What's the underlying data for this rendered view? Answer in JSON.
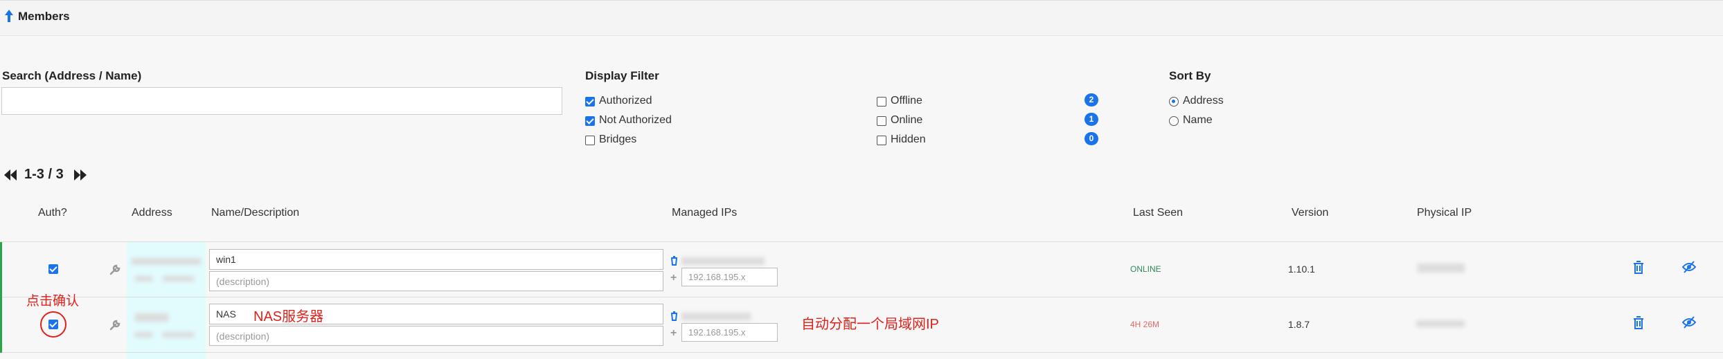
{
  "header": {
    "title": "Members"
  },
  "search": {
    "label": "Search (Address / Name)",
    "value": ""
  },
  "display_filter": {
    "label": "Display Filter",
    "options": [
      {
        "label": "Authorized",
        "checked": true
      },
      {
        "label": "Not Authorized",
        "checked": true
      },
      {
        "label": "Bridges",
        "checked": false
      }
    ],
    "status_options": [
      {
        "label": "Offline",
        "checked": false,
        "count": "2"
      },
      {
        "label": "Online",
        "checked": false,
        "count": "1"
      },
      {
        "label": "Hidden",
        "checked": false,
        "count": "0"
      }
    ]
  },
  "sort_by": {
    "label": "Sort By",
    "options": [
      {
        "label": "Address",
        "selected": true
      },
      {
        "label": "Name",
        "selected": false
      }
    ]
  },
  "pagination": {
    "range": "1-3 / 3"
  },
  "table": {
    "headers": [
      "Auth?",
      "Address",
      "Name/Description",
      "Managed IPs",
      "Last Seen",
      "Version",
      "Physical IP"
    ],
    "rows": [
      {
        "authorized": true,
        "name": "win1",
        "description_placeholder": "(description)",
        "ip_placeholder": "192.168.195.x",
        "last_seen": "ONLINE",
        "version": "1.10.1"
      },
      {
        "authorized": true,
        "name": "NAS",
        "description_placeholder": "(description)",
        "ip_placeholder": "192.168.195.x",
        "last_seen": "4H 26M",
        "version": "1.8.7"
      }
    ]
  },
  "annotations": {
    "confirm": "点击确认",
    "nas_server": "NAS服务器",
    "auto_ip": "自动分配一个局域网IP"
  },
  "colors": {
    "accent": "#1a73e8",
    "online": "#2e8b57",
    "offline": "#e06666",
    "annotation": "#e0201a"
  }
}
